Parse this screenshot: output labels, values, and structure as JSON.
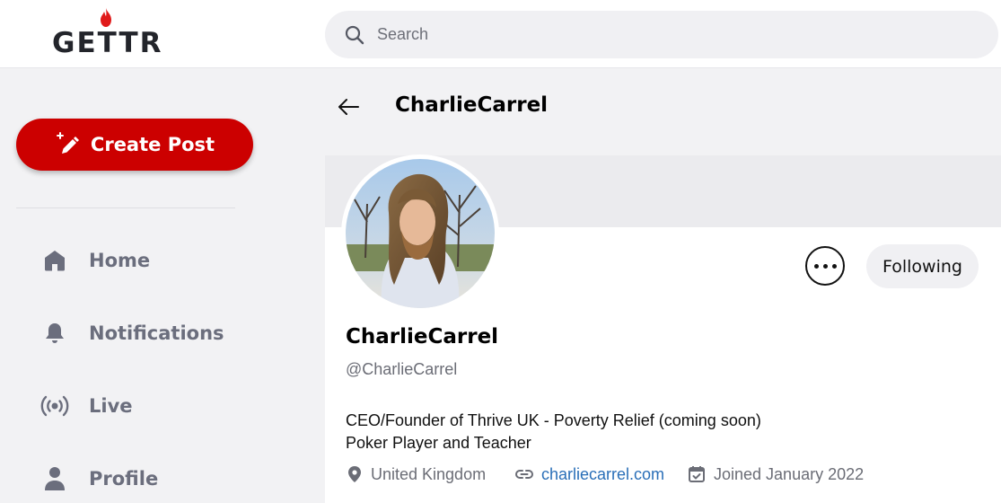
{
  "brand": {
    "logo_text": "GETTR",
    "accent": "#cc0000"
  },
  "search": {
    "placeholder": "Search",
    "icon": "search-icon"
  },
  "sidebar": {
    "create_post": {
      "label": "Create Post",
      "icon": "pencil-sparkle-icon"
    },
    "items": [
      {
        "label": "Home",
        "icon": "home-icon"
      },
      {
        "label": "Notifications",
        "icon": "bell-icon"
      },
      {
        "label": "Live",
        "icon": "broadcast-icon"
      },
      {
        "label": "Profile",
        "icon": "person-icon"
      }
    ]
  },
  "header": {
    "title": "CharlieCarrel",
    "back_icon": "arrow-left-icon"
  },
  "profile": {
    "display_name": "CharlieCarrel",
    "handle": "@CharlieCarrel",
    "bio": [
      "CEO/Founder of Thrive UK - Poverty Relief (coming soon)",
      "Poker Player and Teacher"
    ],
    "location": "United Kingdom",
    "website": "charliecarrel.com",
    "joined": "Joined January 2022",
    "follow_button": "Following",
    "more_icon": "more-horizontal-icon"
  }
}
